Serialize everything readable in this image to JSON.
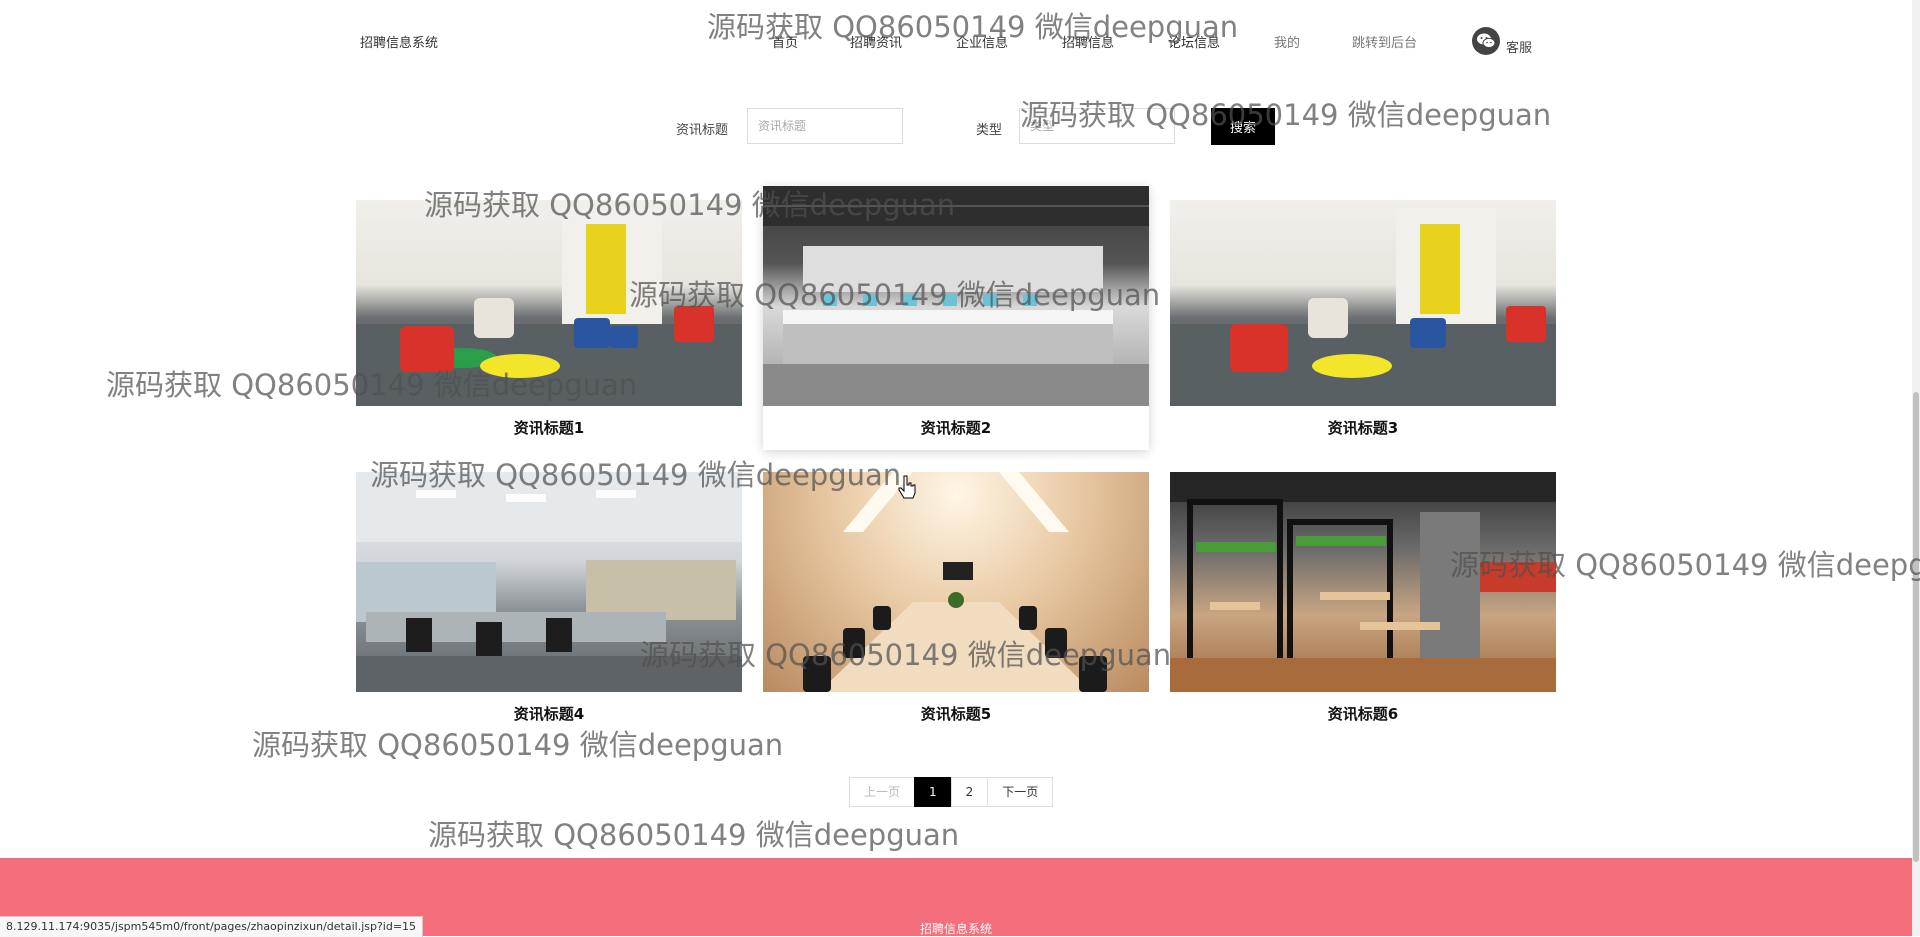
{
  "header": {
    "site_name": "招聘信息系统",
    "nav": [
      "首页",
      "招聘资讯",
      "企业信息",
      "招聘信息",
      "论坛信息",
      "我的",
      "跳转到后台"
    ],
    "customer_service": "客服"
  },
  "search": {
    "title_label": "资讯标题",
    "title_placeholder": "资讯标题",
    "type_label": "类型",
    "type_placeholder": "类型",
    "button": "搜索"
  },
  "cards": [
    {
      "title": "资讯标题1",
      "photo": "lounge-photo"
    },
    {
      "title": "资讯标题2",
      "photo": "office-photo"
    },
    {
      "title": "资讯标题3",
      "photo": "lounge-photo"
    },
    {
      "title": "资讯标题4",
      "photo": "open-office-photo"
    },
    {
      "title": "资讯标题5",
      "photo": "meeting-room-photo"
    },
    {
      "title": "资讯标题6",
      "photo": "cafe-photo"
    }
  ],
  "pagination": {
    "prev": "上一页",
    "pages": [
      "1",
      "2"
    ],
    "current": "1",
    "next": "下一页"
  },
  "footer": {
    "text": "招聘信息系统"
  },
  "status_url": "8.129.11.174:9035/jspm545m0/front/pages/zhaopinzixun/detail.jsp?id=15",
  "watermark": "源码获取 QQ86050149 微信deepguan",
  "colors": {
    "footer": "#f46f7b",
    "button": "#000000",
    "active_page": "#000000"
  }
}
